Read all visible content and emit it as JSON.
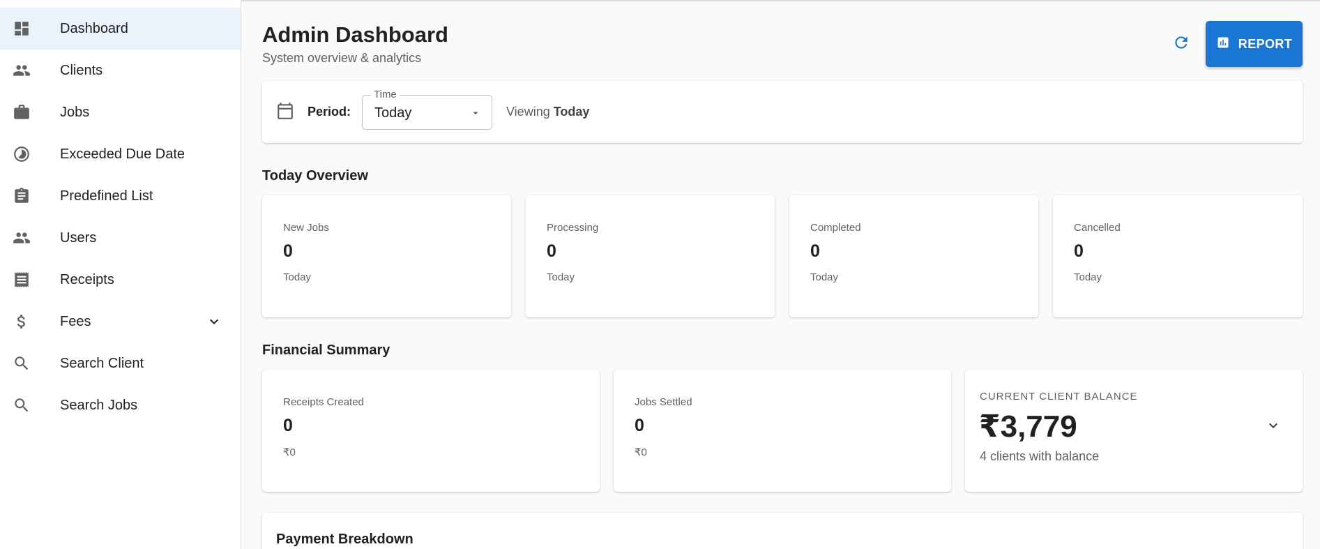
{
  "sidebar": {
    "items": [
      {
        "label": "Dashboard",
        "icon": "dashboard-icon",
        "active": true
      },
      {
        "label": "Clients",
        "icon": "people-icon"
      },
      {
        "label": "Jobs",
        "icon": "briefcase-icon"
      },
      {
        "label": "Exceeded Due Date",
        "icon": "timelapse-icon"
      },
      {
        "label": "Predefined List",
        "icon": "clipboard-icon"
      },
      {
        "label": "Users",
        "icon": "people-icon"
      },
      {
        "label": "Receipts",
        "icon": "receipt-icon"
      },
      {
        "label": "Fees",
        "icon": "dollar-icon",
        "has_submenu": true
      },
      {
        "label": "Search Client",
        "icon": "search-icon"
      },
      {
        "label": "Search Jobs",
        "icon": "search-icon"
      }
    ]
  },
  "header": {
    "title": "Admin Dashboard",
    "subtitle": "System overview & analytics",
    "report_label": "REPORT"
  },
  "period": {
    "label": "Period:",
    "select_legend": "Time",
    "select_value": "Today",
    "viewing_prefix": "Viewing",
    "viewing_value": "Today"
  },
  "overview": {
    "title": "Today Overview",
    "cards": [
      {
        "label": "New Jobs",
        "value": "0",
        "sub": "Today"
      },
      {
        "label": "Processing",
        "value": "0",
        "sub": "Today"
      },
      {
        "label": "Completed",
        "value": "0",
        "sub": "Today"
      },
      {
        "label": "Cancelled",
        "value": "0",
        "sub": "Today"
      }
    ]
  },
  "financial": {
    "title": "Financial Summary",
    "cards": [
      {
        "label": "Receipts Created",
        "value": "0",
        "sub": "₹0"
      },
      {
        "label": "Jobs Settled",
        "value": "0",
        "sub": "₹0"
      }
    ],
    "balance": {
      "label": "CURRENT CLIENT BALANCE",
      "value": "₹3,779",
      "sub": "4 clients with balance"
    }
  },
  "payment": {
    "title": "Payment Breakdown"
  },
  "colors": {
    "accent": "#1976d2",
    "active_nav_bg": "#eaf2fb"
  }
}
